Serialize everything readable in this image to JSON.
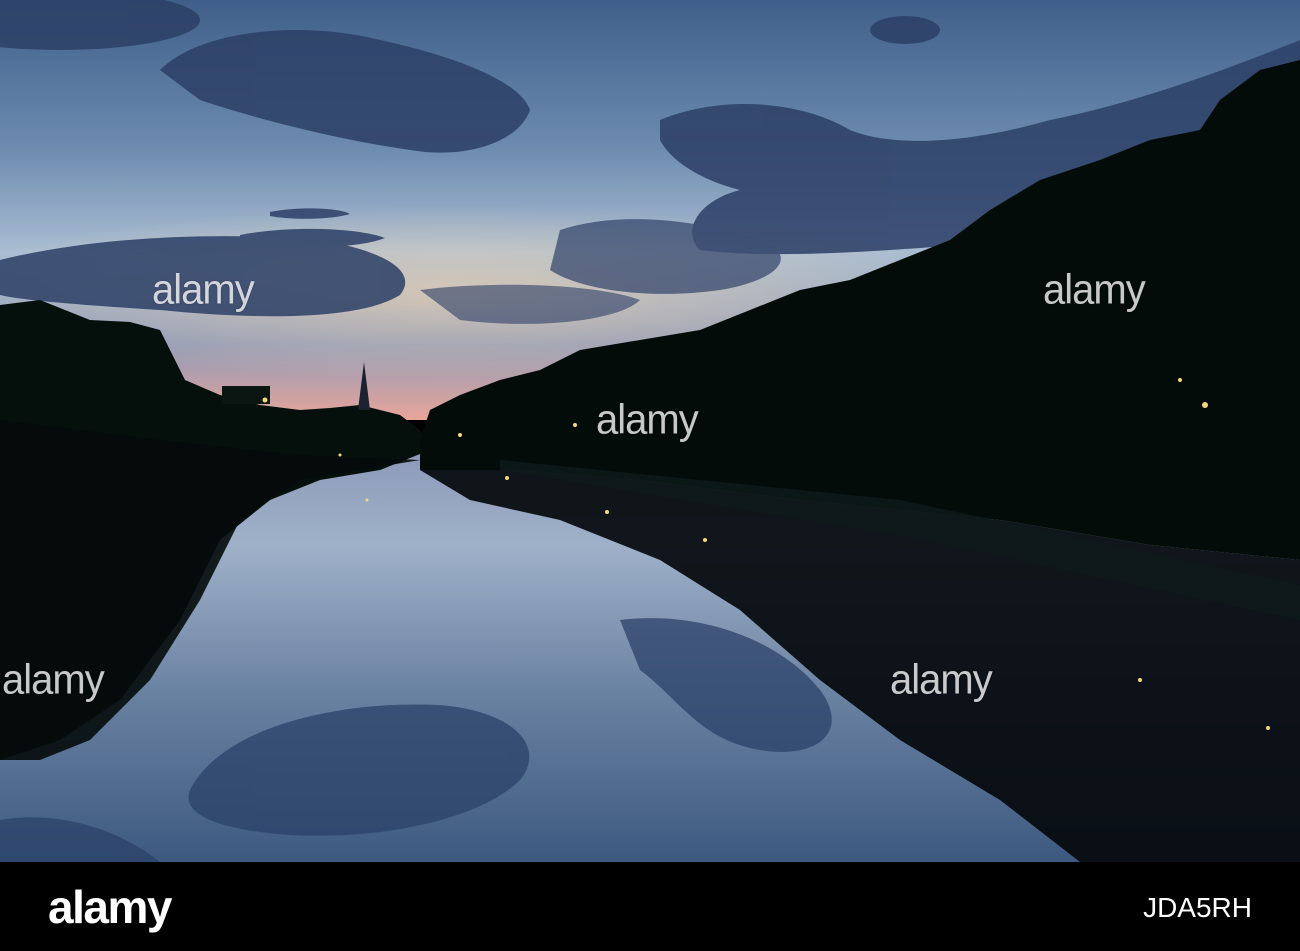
{
  "photo": {
    "description_icon": "river-dusk-photo",
    "colors": {
      "sky_top": "#4a6a92",
      "sky_mid": "#9fb4c8",
      "horizon": "#f2b3a0",
      "trees": "#06100d",
      "water": "#6f88a6"
    }
  },
  "watermark": {
    "text": "alamy"
  },
  "footer": {
    "brand": "alamy",
    "image_code": "JDA5RH"
  }
}
